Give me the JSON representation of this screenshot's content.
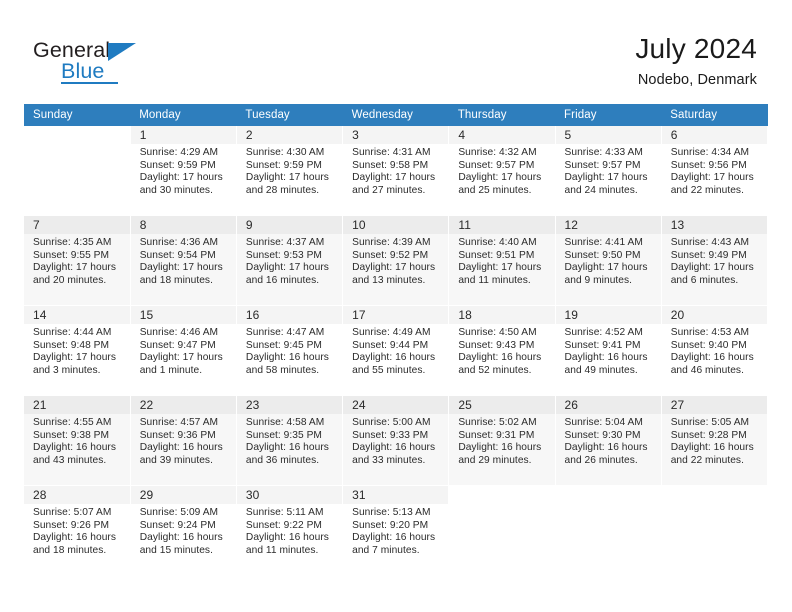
{
  "brand": {
    "name_top": "General",
    "name_bottom": "Blue",
    "triangle_icon": "triangle-icon",
    "accent_color": "#1f7bc1"
  },
  "header": {
    "title": "July 2024",
    "subtitle": "Nodebo, Denmark"
  },
  "colors": {
    "header_row_bg": "#2e7ebd",
    "header_row_text": "#ffffff",
    "day_number_bg": "#f2f2f2",
    "band_row_bg": "#f7f7f7",
    "text": "#2b2b2b"
  },
  "calendar": {
    "weekday_headers": [
      "Sunday",
      "Monday",
      "Tuesday",
      "Wednesday",
      "Thursday",
      "Friday",
      "Saturday"
    ],
    "labels": {
      "sunrise": "Sunrise:",
      "sunset": "Sunset:",
      "daylight": "Daylight:"
    },
    "weeks": [
      [
        {
          "day": "",
          "lines": []
        },
        {
          "day": "1",
          "lines": [
            "Sunrise: 4:29 AM",
            "Sunset: 9:59 PM",
            "Daylight: 17 hours",
            "and 30 minutes."
          ]
        },
        {
          "day": "2",
          "lines": [
            "Sunrise: 4:30 AM",
            "Sunset: 9:59 PM",
            "Daylight: 17 hours",
            "and 28 minutes."
          ]
        },
        {
          "day": "3",
          "lines": [
            "Sunrise: 4:31 AM",
            "Sunset: 9:58 PM",
            "Daylight: 17 hours",
            "and 27 minutes."
          ]
        },
        {
          "day": "4",
          "lines": [
            "Sunrise: 4:32 AM",
            "Sunset: 9:57 PM",
            "Daylight: 17 hours",
            "and 25 minutes."
          ]
        },
        {
          "day": "5",
          "lines": [
            "Sunrise: 4:33 AM",
            "Sunset: 9:57 PM",
            "Daylight: 17 hours",
            "and 24 minutes."
          ]
        },
        {
          "day": "6",
          "lines": [
            "Sunrise: 4:34 AM",
            "Sunset: 9:56 PM",
            "Daylight: 17 hours",
            "and 22 minutes."
          ]
        }
      ],
      [
        {
          "day": "7",
          "lines": [
            "Sunrise: 4:35 AM",
            "Sunset: 9:55 PM",
            "Daylight: 17 hours",
            "and 20 minutes."
          ]
        },
        {
          "day": "8",
          "lines": [
            "Sunrise: 4:36 AM",
            "Sunset: 9:54 PM",
            "Daylight: 17 hours",
            "and 18 minutes."
          ]
        },
        {
          "day": "9",
          "lines": [
            "Sunrise: 4:37 AM",
            "Sunset: 9:53 PM",
            "Daylight: 17 hours",
            "and 16 minutes."
          ]
        },
        {
          "day": "10",
          "lines": [
            "Sunrise: 4:39 AM",
            "Sunset: 9:52 PM",
            "Daylight: 17 hours",
            "and 13 minutes."
          ]
        },
        {
          "day": "11",
          "lines": [
            "Sunrise: 4:40 AM",
            "Sunset: 9:51 PM",
            "Daylight: 17 hours",
            "and 11 minutes."
          ]
        },
        {
          "day": "12",
          "lines": [
            "Sunrise: 4:41 AM",
            "Sunset: 9:50 PM",
            "Daylight: 17 hours",
            "and 9 minutes."
          ]
        },
        {
          "day": "13",
          "lines": [
            "Sunrise: 4:43 AM",
            "Sunset: 9:49 PM",
            "Daylight: 17 hours",
            "and 6 minutes."
          ]
        }
      ],
      [
        {
          "day": "14",
          "lines": [
            "Sunrise: 4:44 AM",
            "Sunset: 9:48 PM",
            "Daylight: 17 hours",
            "and 3 minutes."
          ]
        },
        {
          "day": "15",
          "lines": [
            "Sunrise: 4:46 AM",
            "Sunset: 9:47 PM",
            "Daylight: 17 hours",
            "and 1 minute."
          ]
        },
        {
          "day": "16",
          "lines": [
            "Sunrise: 4:47 AM",
            "Sunset: 9:45 PM",
            "Daylight: 16 hours",
            "and 58 minutes."
          ]
        },
        {
          "day": "17",
          "lines": [
            "Sunrise: 4:49 AM",
            "Sunset: 9:44 PM",
            "Daylight: 16 hours",
            "and 55 minutes."
          ]
        },
        {
          "day": "18",
          "lines": [
            "Sunrise: 4:50 AM",
            "Sunset: 9:43 PM",
            "Daylight: 16 hours",
            "and 52 minutes."
          ]
        },
        {
          "day": "19",
          "lines": [
            "Sunrise: 4:52 AM",
            "Sunset: 9:41 PM",
            "Daylight: 16 hours",
            "and 49 minutes."
          ]
        },
        {
          "day": "20",
          "lines": [
            "Sunrise: 4:53 AM",
            "Sunset: 9:40 PM",
            "Daylight: 16 hours",
            "and 46 minutes."
          ]
        }
      ],
      [
        {
          "day": "21",
          "lines": [
            "Sunrise: 4:55 AM",
            "Sunset: 9:38 PM",
            "Daylight: 16 hours",
            "and 43 minutes."
          ]
        },
        {
          "day": "22",
          "lines": [
            "Sunrise: 4:57 AM",
            "Sunset: 9:36 PM",
            "Daylight: 16 hours",
            "and 39 minutes."
          ]
        },
        {
          "day": "23",
          "lines": [
            "Sunrise: 4:58 AM",
            "Sunset: 9:35 PM",
            "Daylight: 16 hours",
            "and 36 minutes."
          ]
        },
        {
          "day": "24",
          "lines": [
            "Sunrise: 5:00 AM",
            "Sunset: 9:33 PM",
            "Daylight: 16 hours",
            "and 33 minutes."
          ]
        },
        {
          "day": "25",
          "lines": [
            "Sunrise: 5:02 AM",
            "Sunset: 9:31 PM",
            "Daylight: 16 hours",
            "and 29 minutes."
          ]
        },
        {
          "day": "26",
          "lines": [
            "Sunrise: 5:04 AM",
            "Sunset: 9:30 PM",
            "Daylight: 16 hours",
            "and 26 minutes."
          ]
        },
        {
          "day": "27",
          "lines": [
            "Sunrise: 5:05 AM",
            "Sunset: 9:28 PM",
            "Daylight: 16 hours",
            "and 22 minutes."
          ]
        }
      ],
      [
        {
          "day": "28",
          "lines": [
            "Sunrise: 5:07 AM",
            "Sunset: 9:26 PM",
            "Daylight: 16 hours",
            "and 18 minutes."
          ]
        },
        {
          "day": "29",
          "lines": [
            "Sunrise: 5:09 AM",
            "Sunset: 9:24 PM",
            "Daylight: 16 hours",
            "and 15 minutes."
          ]
        },
        {
          "day": "30",
          "lines": [
            "Sunrise: 5:11 AM",
            "Sunset: 9:22 PM",
            "Daylight: 16 hours",
            "and 11 minutes."
          ]
        },
        {
          "day": "31",
          "lines": [
            "Sunrise: 5:13 AM",
            "Sunset: 9:20 PM",
            "Daylight: 16 hours",
            "and 7 minutes."
          ]
        },
        {
          "day": "",
          "lines": []
        },
        {
          "day": "",
          "lines": []
        },
        {
          "day": "",
          "lines": []
        }
      ]
    ]
  }
}
